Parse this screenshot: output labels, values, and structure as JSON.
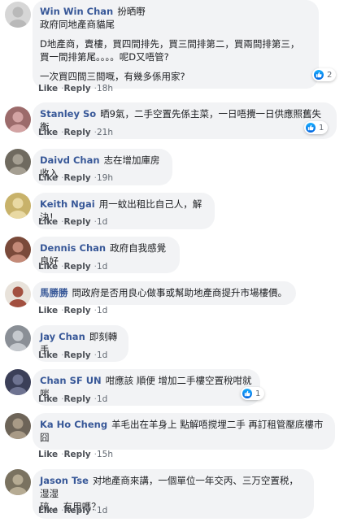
{
  "colors": {
    "name": "#385898",
    "bubble": "#f2f3f5",
    "text": "#1c1e21",
    "meta": "#606770",
    "like": "#1877f2"
  },
  "actions": {
    "like": "Like",
    "reply": "Reply",
    "separator": "·"
  },
  "comments": [
    {
      "author": "Win Win Chan",
      "paragraphs": [
        [
          "扮晒嘢",
          "政府同地產商貓尾"
        ],
        [
          "D地產商，賣樓，買四間排先，買三間排第二，買兩間排第三，",
          "買一間排第尾。。。。呢D又唔管?"
        ],
        [
          "一次買四間三間嘅，有幾多係用家?"
        ]
      ],
      "time": "18h",
      "reactions": "2",
      "avatar_icon": "user-avatar"
    },
    {
      "author": "Stanley So",
      "paragraphs": [
        [
          "晒9氣，二手空置先係主菜，一日唔攪一日供應照舊失衡"
        ]
      ],
      "time": "21h",
      "reactions": "1",
      "avatar_icon": "user-avatar"
    },
    {
      "author": "Daivd Chan",
      "paragraphs": [
        [
          "志在增加庫房收入"
        ]
      ],
      "time": "19h",
      "reactions": "",
      "avatar_icon": "user-avatar"
    },
    {
      "author": "Keith Ngai",
      "paragraphs": [
        [
          "用一蚊出租比自己人，解決！"
        ]
      ],
      "time": "1d",
      "reactions": "",
      "avatar_icon": "user-avatar"
    },
    {
      "author": "Dennis Chan",
      "paragraphs": [
        [
          "政府自我感覺良好"
        ]
      ],
      "time": "1d",
      "reactions": "",
      "avatar_icon": "user-avatar"
    },
    {
      "author": "馬勝勝",
      "paragraphs": [
        [
          "問政府是否用良心做事或幫助地產商提升市場樓價。"
        ]
      ],
      "time": "1d",
      "reactions": "",
      "avatar_icon": "user-avatar"
    },
    {
      "author": "Jay Chan",
      "paragraphs": [
        [
          "即刻轉手"
        ]
      ],
      "time": "1d",
      "reactions": "",
      "avatar_icon": "user-avatar"
    },
    {
      "author": "Chan SF UN",
      "paragraphs": [
        [
          "咁應該 順便 增加二手樓空置稅咁就啱"
        ]
      ],
      "time": "1d",
      "reactions": "1",
      "avatar_icon": "user-avatar"
    },
    {
      "author": "Ka Ho Cheng",
      "paragraphs": [
        [
          "羊毛出在羊身上 點解唔搅埋二手 再訂租管壓底樓市",
          "囧"
        ]
      ],
      "time": "15h",
      "reactions": "",
      "avatar_icon": "user-avatar"
    },
    {
      "author": "Jason Tse",
      "paragraphs": [
        [
          "对地產商來講，一個單位一年交丙、三万空置税，湿湿",
          "碎。。有用嗎？"
        ]
      ],
      "time": "1d",
      "reactions": "",
      "avatar_icon": "user-avatar"
    }
  ]
}
